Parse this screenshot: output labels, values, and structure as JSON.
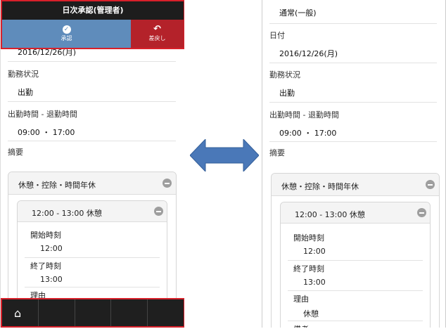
{
  "header": {
    "title": "日次承認(管理者)",
    "approve_label": "承認",
    "approve_icon": "check-icon",
    "reject_label": "差戻し",
    "reject_icon": "undo-icon",
    "approve_color": "#5f8cbb",
    "reject_color": "#b4222a"
  },
  "left": {
    "date_value": "2016/12/26(月)",
    "status_label": "勤務状況",
    "status_value": "出勤",
    "time_label": "出勤時間 - 退勤時間",
    "time_value": "09:00 ・ 17:00",
    "summary_label": "摘要",
    "box_title": "休憩・控除・時間年休",
    "inner_title": "12:00 - 13:00 休憩",
    "start_label": "開始時刻",
    "start_value": "12:00",
    "end_label": "終了時刻",
    "end_value": "13:00",
    "reason_label": "理由"
  },
  "footer": {
    "home_icon": "home-icon",
    "highlight_color": "#d8202a"
  },
  "right": {
    "type_value": "通常(一般)",
    "date_label": "日付",
    "date_value": "2016/12/26(月)",
    "status_label": "勤務状況",
    "status_value": "出勤",
    "time_label": "出勤時間 - 退勤時間",
    "time_value": "09:00 ・ 17:00",
    "summary_label": "摘要",
    "box_title": "休憩・控除・時間年休",
    "inner_title": "12:00 - 13:00 休憩",
    "start_label": "開始時刻",
    "start_value": "12:00",
    "end_label": "終了時刻",
    "end_value": "13:00",
    "reason_label": "理由",
    "reason_value": "休憩",
    "note_label": "備考"
  },
  "arrow": {
    "icon": "double-arrow-icon",
    "color": "#4a78b8"
  }
}
